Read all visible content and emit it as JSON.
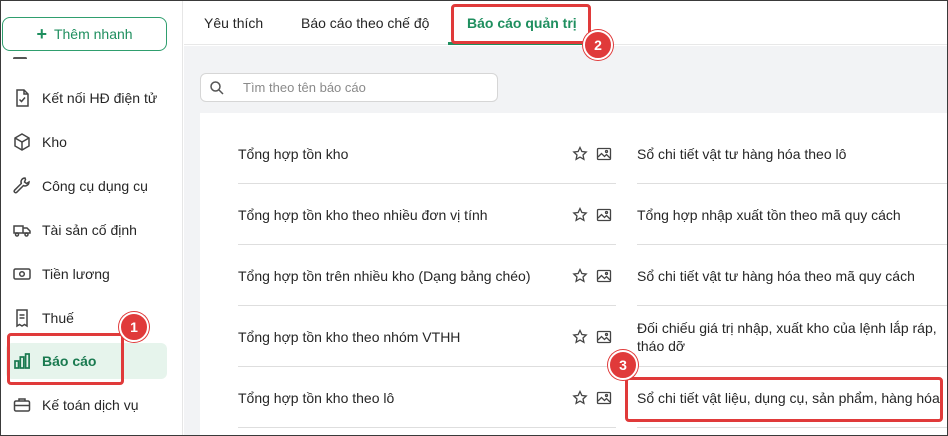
{
  "sidebar": {
    "quick_add_label": "Thêm nhanh",
    "items": [
      {
        "label": "Kết nối HĐ điện tử",
        "icon": "doc-check-icon"
      },
      {
        "label": "Kho",
        "icon": "box-icon"
      },
      {
        "label": "Công cụ dụng cụ",
        "icon": "wrench-icon"
      },
      {
        "label": "Tài sản cố định",
        "icon": "truck-icon"
      },
      {
        "label": "Tiền lương",
        "icon": "cash-icon"
      },
      {
        "label": "Thuế",
        "icon": "receipt-icon"
      },
      {
        "label": "Báo cáo",
        "icon": "bar-chart-icon",
        "active": true
      },
      {
        "label": "Kế toán dịch vụ",
        "icon": "briefcase-icon"
      }
    ]
  },
  "tabs": [
    {
      "label": "Yêu thích"
    },
    {
      "label": "Báo cáo theo chế độ"
    },
    {
      "label": "Báo cáo quản trị",
      "active": true
    }
  ],
  "search": {
    "placeholder": "Tìm theo tên báo cáo"
  },
  "reports_left": [
    "Tổng hợp tồn kho",
    "Tổng hợp tồn kho theo nhiều đơn vị tính",
    "Tổng hợp tồn trên nhiều kho (Dạng bảng chéo)",
    "Tổng hợp tồn kho theo nhóm VTHH",
    "Tổng hợp tồn kho theo lô"
  ],
  "reports_right": [
    "Sổ chi tiết vật tư hàng hóa theo lô",
    "Tổng hợp nhập xuất tồn theo mã quy cách",
    "Sổ chi tiết vật tư hàng hóa theo mã quy cách",
    "Đối chiếu giá trị nhập, xuất kho của lệnh lắp ráp, tháo dỡ",
    "Sổ chi tiết vật liệu, dụng cụ, sản phẩm, hàng hóa"
  ],
  "callouts": [
    "1",
    "2",
    "3"
  ],
  "colors": {
    "accent": "#1f8f5f",
    "callout": "#e03a3a",
    "active_bg": "#e6f4ec"
  }
}
